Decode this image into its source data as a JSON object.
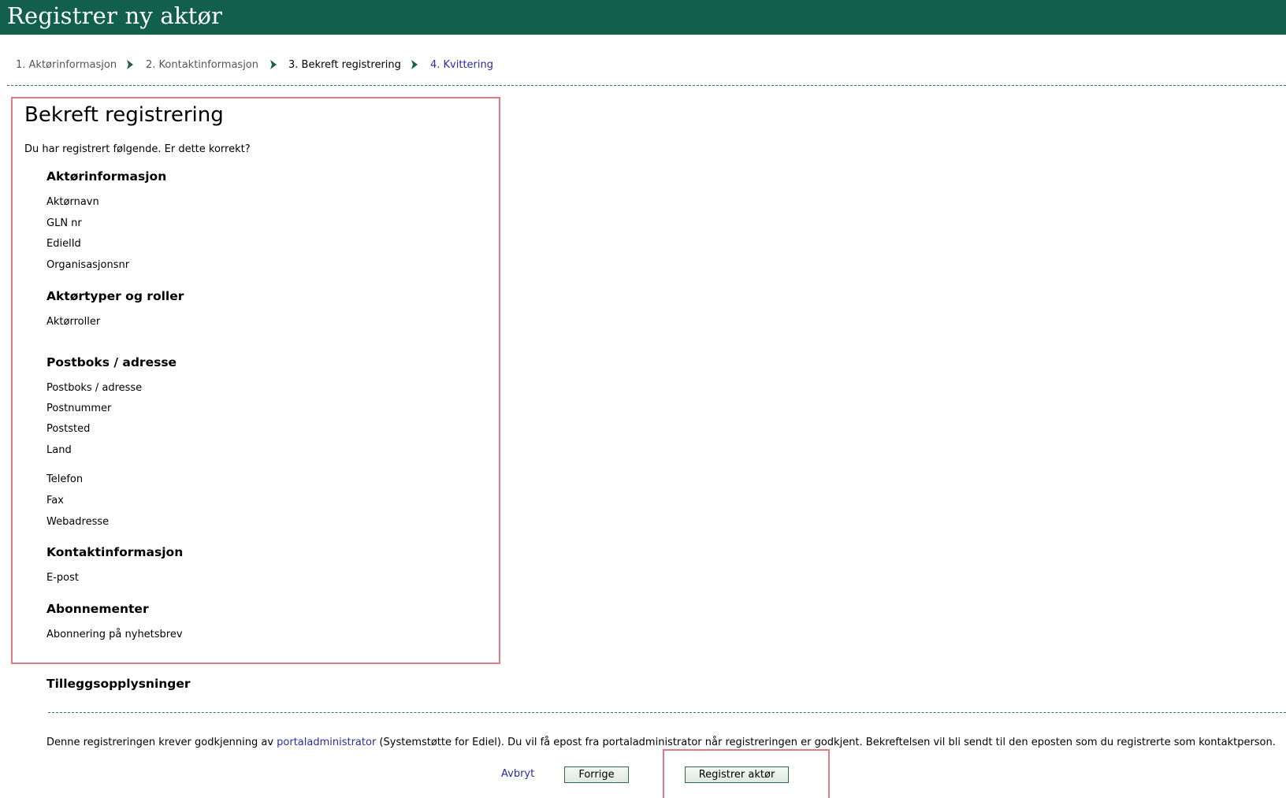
{
  "header": {
    "title": "Registrer ny aktør"
  },
  "steps": [
    {
      "label": "1. Aktørinformasjon",
      "state": "done"
    },
    {
      "label": "2. Kontaktinformasjon",
      "state": "done"
    },
    {
      "label": "3. Bekreft registrering",
      "state": "active"
    },
    {
      "label": "4. Kvittering",
      "state": "next"
    }
  ],
  "confirm": {
    "title": "Bekreft registrering",
    "intro": "Du har registrert følgende. Er dette korrekt?",
    "sections": {
      "actor_info": {
        "heading": "Aktørinformasjon",
        "fields": [
          "Aktørnavn",
          "GLN nr",
          "EdielId",
          "Organisasjonsnr"
        ]
      },
      "actor_types": {
        "heading": "Aktørtyper og roller",
        "fields": [
          "Aktørroller"
        ]
      },
      "address": {
        "heading": "Postboks / adresse",
        "fields": [
          "Postboks / adresse",
          "Postnummer",
          "Poststed",
          "Land",
          "Telefon",
          "Fax",
          "Webadresse"
        ]
      },
      "contact": {
        "heading": "Kontaktinformasjon",
        "fields": [
          "E-post"
        ]
      },
      "subscriptions": {
        "heading": "Abonnementer",
        "fields": [
          "Abonnering på nyhetsbrev"
        ]
      }
    }
  },
  "additional": {
    "heading": "Tilleggsopplysninger"
  },
  "note": {
    "before": "Denne registreringen krever godkjenning av ",
    "link": "portaladministrator",
    "after": " (Systemstøtte for Ediel). Du vil få epost fra portaladministrator når registreringen er godkjent. Bekreftelsen vil bli sendt til den eposten som du registrerte som kontaktperson."
  },
  "actions": {
    "cancel_label": "Avbryt",
    "previous_label": "Forrige",
    "register_label": "Registrer aktør"
  },
  "colors": {
    "header_bg": "#125f4c",
    "highlight_border": "#e07a86",
    "link": "#2b2b9c"
  }
}
